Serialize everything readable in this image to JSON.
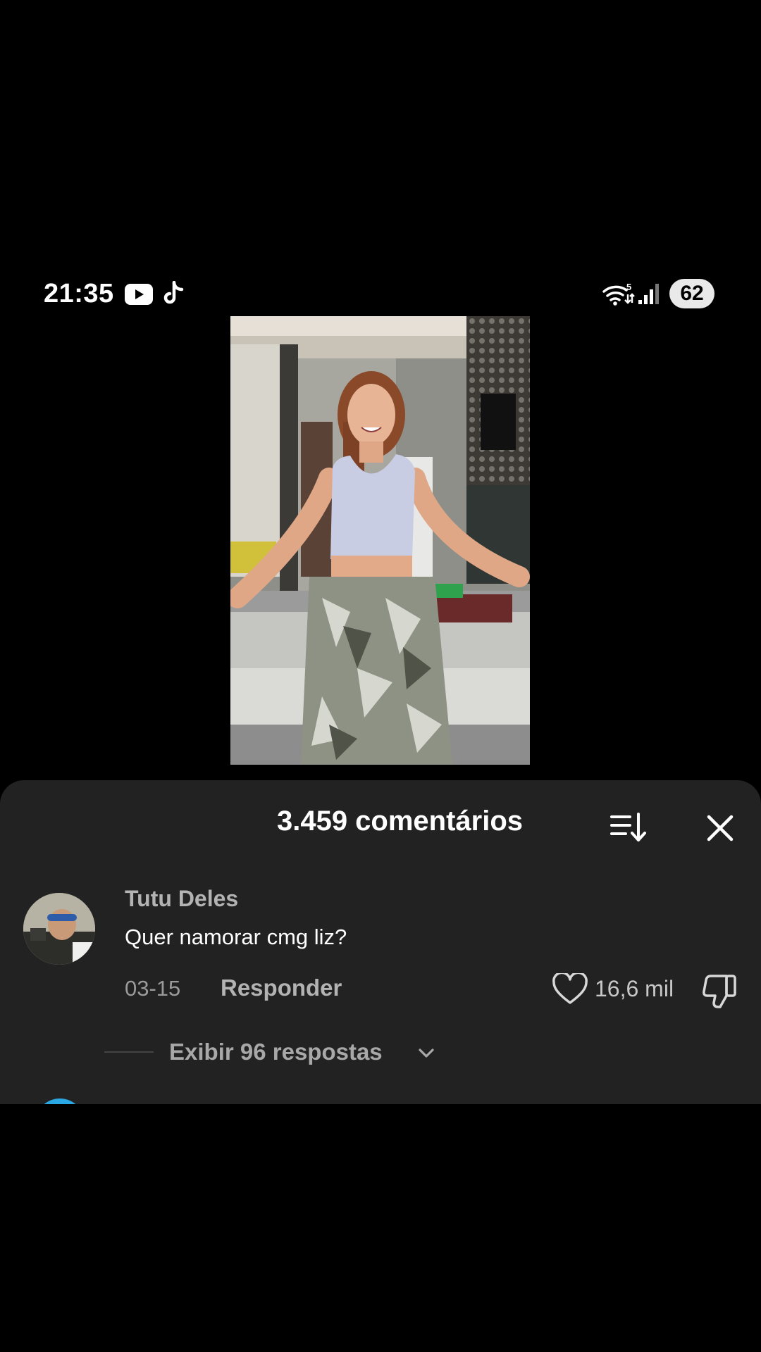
{
  "status_bar": {
    "time": "21:35",
    "wifi_badge": "5",
    "battery": "62",
    "icons": [
      "youtube-icon",
      "tiktok-icon",
      "wifi-icon",
      "signal-icon"
    ]
  },
  "comments_sheet": {
    "title": "3.459 comentários",
    "icons": [
      "sort-icon",
      "close-icon"
    ],
    "comments": [
      {
        "username": "Tutu Deles",
        "text": "Quer namorar cmg liz?",
        "date": "03-15",
        "reply_label": "Responder",
        "likes": "16,6 mil",
        "view_replies": "Exibir 96 respostas"
      }
    ]
  },
  "colors": {
    "sheet_background": "#222222",
    "page_background": "#000000",
    "secondary_text": "#b3b3b3",
    "next_avatar": "#2aa8e6"
  }
}
